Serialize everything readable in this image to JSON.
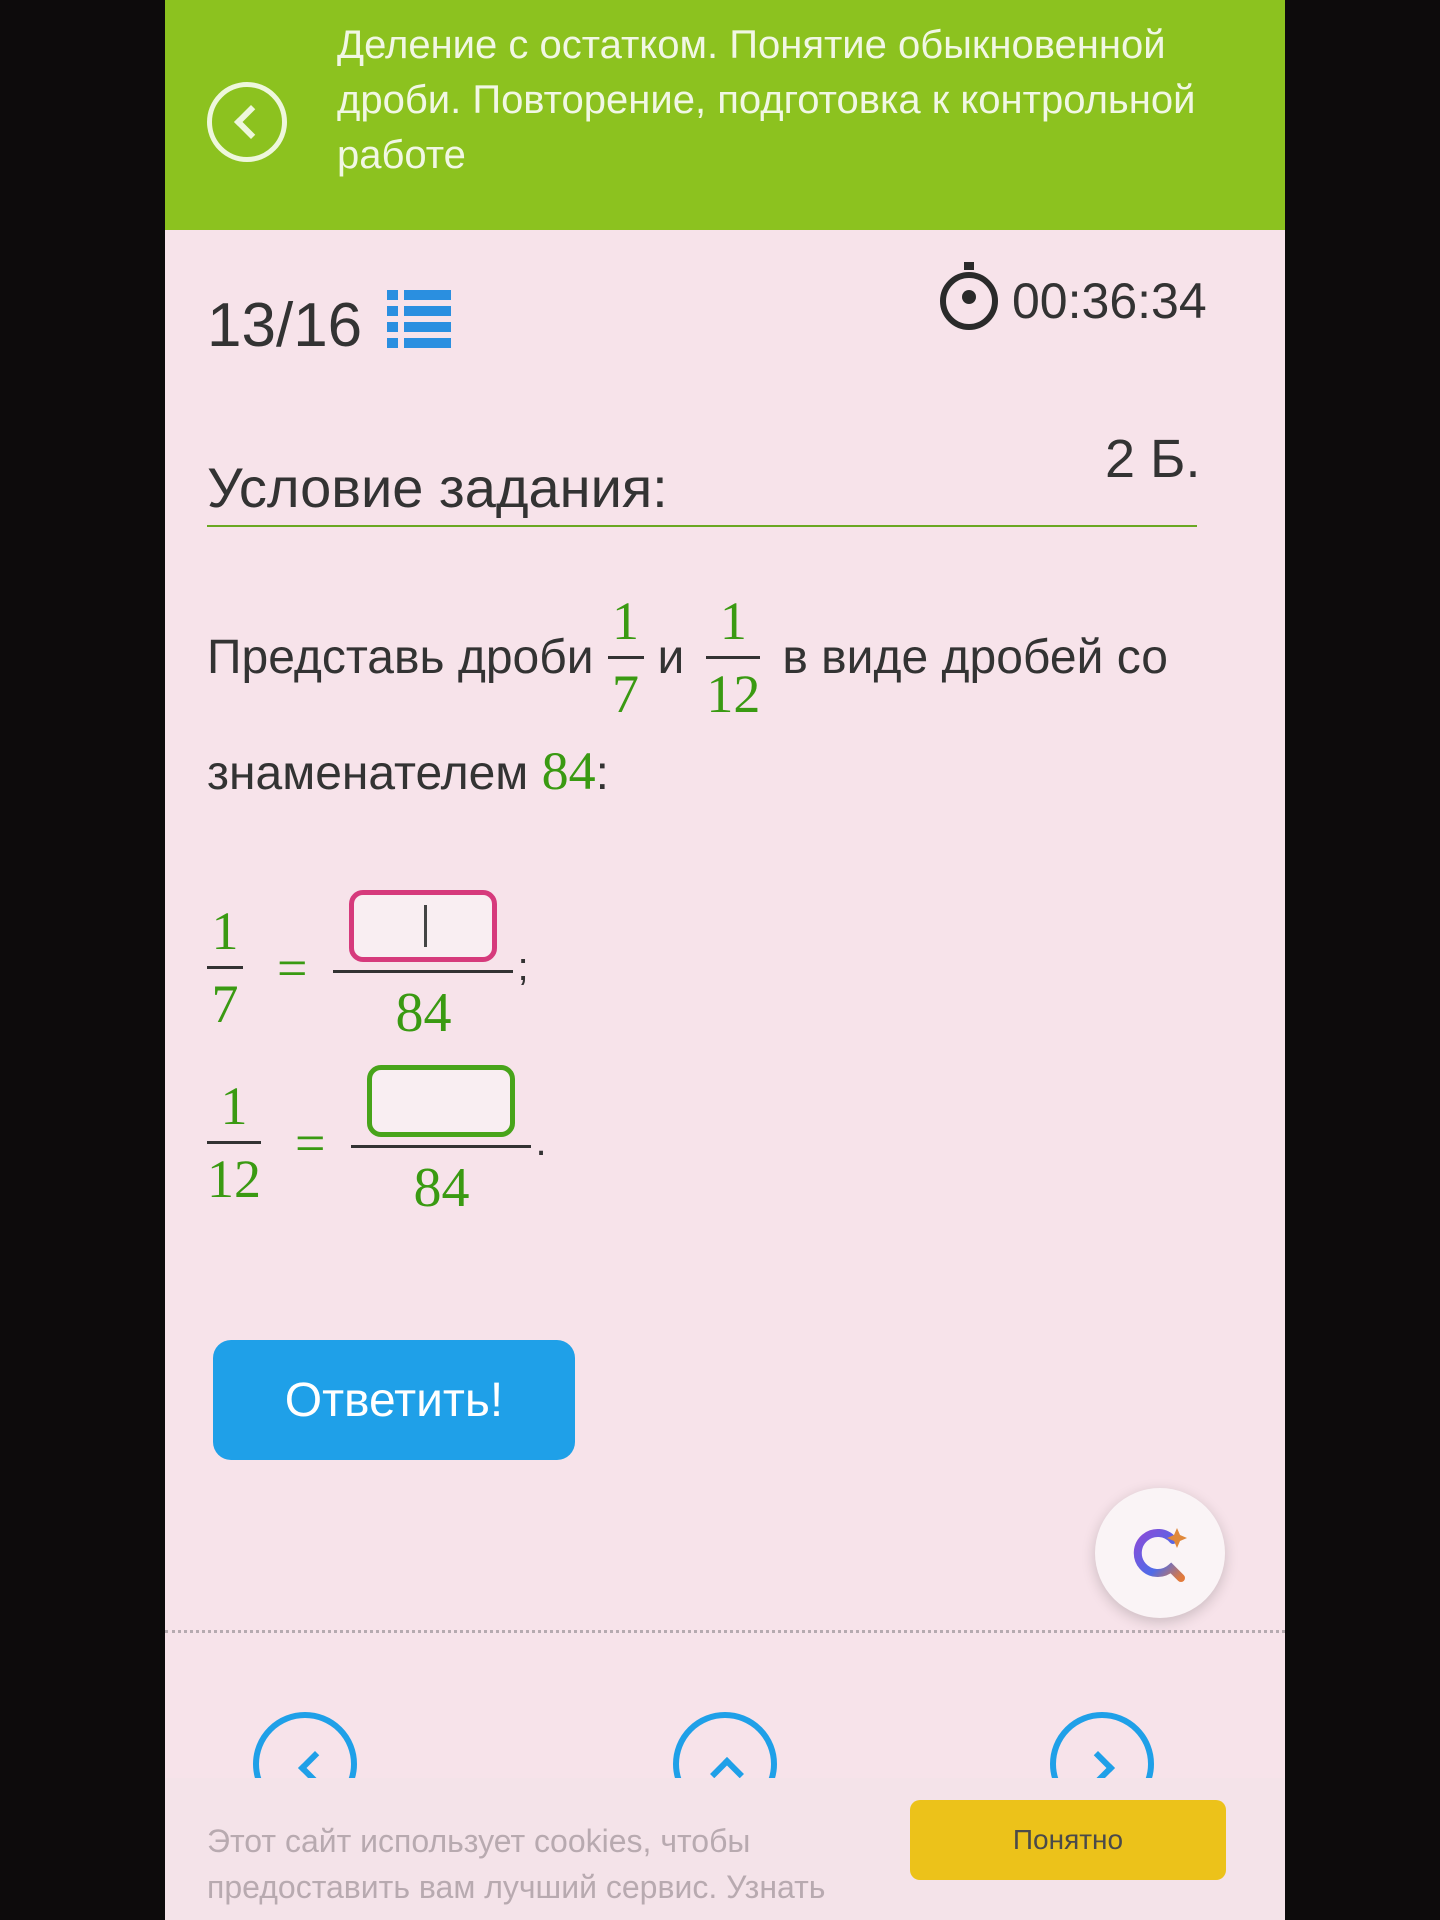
{
  "header": {
    "title": "Деление с остатком. Понятие обыкновенной дроби. Повторение, подготовка к контрольной работе"
  },
  "progress": {
    "counter": "13/16",
    "timer": "00:36:34"
  },
  "task": {
    "section_title": "Условие задания:",
    "points": "2 Б.",
    "text_start": "Представь дроби",
    "text_and": "и",
    "text_end": "в виде дробей со",
    "text_line2": "знаменателем",
    "denominator": "84",
    "colon": ":",
    "fraction1": {
      "num": "1",
      "den": "7"
    },
    "fraction2": {
      "num": "1",
      "den": "12"
    }
  },
  "equations": [
    {
      "lhs_num": "1",
      "lhs_den": "7",
      "eq": "=",
      "rhs_den": "84",
      "punct": ";",
      "answer_value": ""
    },
    {
      "lhs_num": "1",
      "lhs_den": "12",
      "eq": "=",
      "rhs_den": "84",
      "punct": ".",
      "answer_value": ""
    }
  ],
  "actions": {
    "submit_label": "Ответить!"
  },
  "cookie": {
    "text": "Этот сайт использует cookies, чтобы предоставить вам лучший сервис. Узнать больше",
    "accept_label": "Понятно"
  },
  "colors": {
    "header_bg": "#8cc21f",
    "accent_green": "#3a9a12",
    "button_blue": "#1fa0e8",
    "active_input_border": "#d63a7c",
    "cookie_button": "#ecc21a"
  },
  "icons": [
    "back-icon",
    "list-icon",
    "stopwatch-icon",
    "assistant-icon",
    "prev-icon",
    "up-icon",
    "next-icon"
  ]
}
